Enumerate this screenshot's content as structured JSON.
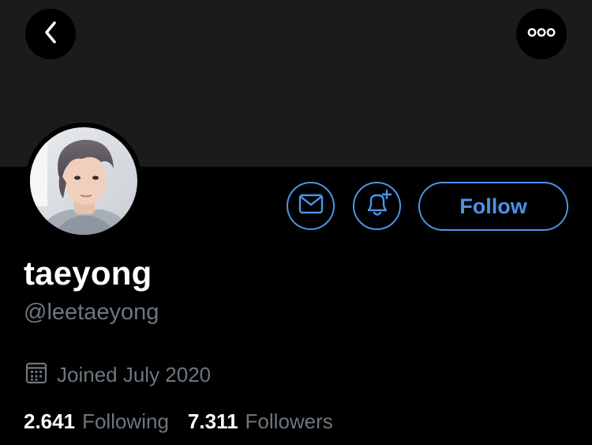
{
  "header": {
    "back_icon": "chevron-left-icon",
    "more_icon": "more-dots-icon"
  },
  "profile": {
    "display_name": "taeyong",
    "handle": "@leetaeyong",
    "joined": "Joined July 2020",
    "following_count": "2.641",
    "following_label": "Following",
    "followers_count": "7.311",
    "followers_label": "Followers"
  },
  "actions": {
    "message_icon": "mail-icon",
    "notify_icon": "bell-plus-icon",
    "follow_label": "Follow"
  },
  "colors": {
    "background": "#000000",
    "banner": "#1b1b1c",
    "accent": "#4d93e6",
    "secondary_text": "#6e767d",
    "primary_text": "#ffffff"
  }
}
